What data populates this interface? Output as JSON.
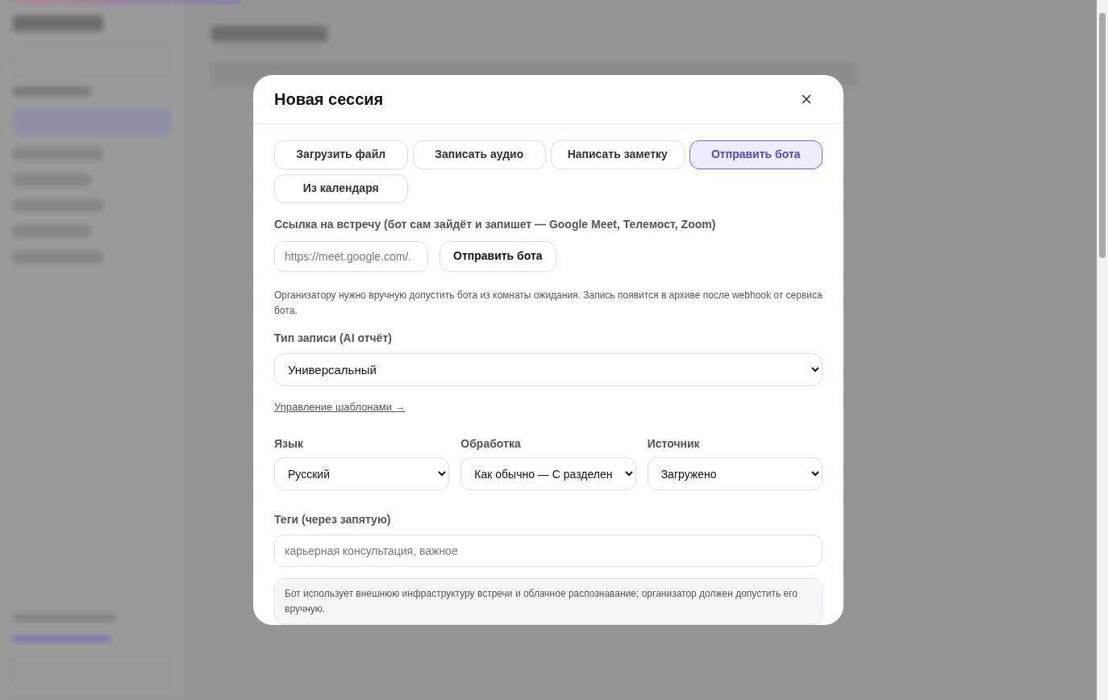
{
  "modal": {
    "title": "Новая сессия",
    "tabs": [
      {
        "label": "Загрузить файл",
        "selected": false
      },
      {
        "label": "Записать аудио",
        "selected": false
      },
      {
        "label": "Написать заметку",
        "selected": false
      },
      {
        "label": "Отправить бота",
        "selected": true
      },
      {
        "label": "Из календаря",
        "selected": false
      }
    ],
    "meeting_link": {
      "label": "Ссылка на встречу (бот сам зайдёт и запишет — Google Meet, Телемост, Zoom)",
      "placeholder": "https://meet.google.com/.",
      "button": "Отправить бота"
    },
    "note": "Организатору нужно вручную допустить бота из комнаты ожидания. Запись появится в архиве после webhook от сервиса бота.",
    "record_type": {
      "label": "Тип записи (AI отчёт)",
      "value": "Универсальный"
    },
    "templates_link": "Управление шаблонами →",
    "selects": [
      {
        "label": "Язык",
        "value": "Русский"
      },
      {
        "label": "Обработка",
        "value": "Как обычно — С разделен"
      },
      {
        "label": "Источник",
        "value": "Загружено"
      }
    ],
    "tags": {
      "label": "Теги (через запятую)",
      "placeholder": "карьерная консультация, важное"
    },
    "info": "Бот использует внешнюю инфраструктуру встречи и облачное распознавание; организатор должен допустить его вручную."
  }
}
